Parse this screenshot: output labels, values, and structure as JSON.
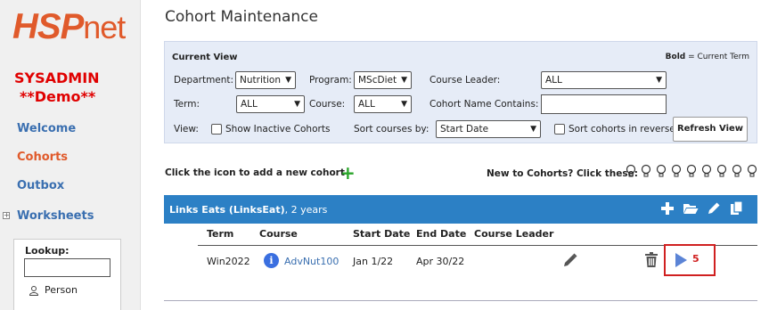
{
  "brand": {
    "logo_a": "HSP",
    "logo_b": "net"
  },
  "user": {
    "role": "SYSADMIN",
    "mode": "**Demo**"
  },
  "sidebar": {
    "items": [
      {
        "label": "Welcome"
      },
      {
        "label": "Cohorts"
      },
      {
        "label": "Outbox"
      },
      {
        "label": "Worksheets"
      }
    ],
    "lookup": {
      "label": "Lookup:",
      "value": "",
      "person_label": "Person"
    }
  },
  "page": {
    "title": "Cohort Maintenance"
  },
  "current_view": {
    "title": "Current View",
    "legend_bold": "Bold",
    "legend_rest": " = Current Term",
    "department": {
      "label": "Department:",
      "value": "Nutrition"
    },
    "program": {
      "label": "Program:",
      "value": "MScDiet"
    },
    "course_leader": {
      "label": "Course Leader:",
      "value": "ALL"
    },
    "term": {
      "label": "Term:",
      "value": "ALL"
    },
    "course": {
      "label": "Course:",
      "value": "ALL"
    },
    "cohort_name": {
      "label": "Cohort Name Contains:",
      "value": ""
    },
    "view": {
      "label": "View:",
      "show_inactive": "Show Inactive Cohorts"
    },
    "sort_by": {
      "label": "Sort courses by:",
      "value": "Start Date"
    },
    "sort_reverse": "Sort cohorts in reverse",
    "refresh_label": "Refresh View"
  },
  "add_hint": "Click the icon to add a new cohort",
  "new_hint": "New to Cohorts? Click these:",
  "cohort": {
    "name": "Links Eats (LinksEat)",
    "duration": ", 2 years",
    "columns": [
      "Term",
      "Course",
      "Start Date",
      "End Date",
      "Course Leader"
    ],
    "rows": [
      {
        "term": "Win2022",
        "course": "AdvNut100",
        "start": "Jan 1/22",
        "end": "Apr 30/22",
        "leader": "",
        "play_count": "5"
      }
    ]
  },
  "colors": {
    "accent": "#2c80c5",
    "brand": "#e05a2b",
    "alert": "#e00000",
    "add_green": "#2aa52a"
  }
}
